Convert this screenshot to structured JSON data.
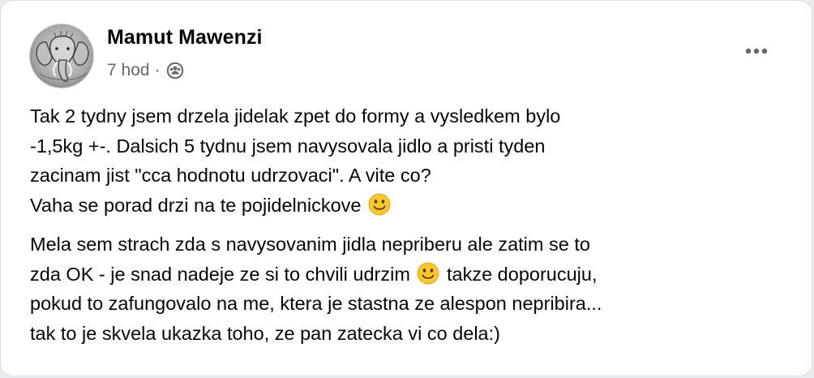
{
  "post": {
    "author": "Mamut Mawenzi",
    "time": "7 hod",
    "separator": "·",
    "audience_icon": "friends-icon",
    "menu_icon": "more-horizontal-icon",
    "paragraphs": [
      {
        "lines": [
          [
            "Tak 2 tydny jsem drzela jidelak zpet do formy a vysledkem bylo"
          ],
          [
            "-1,5kg +-. Dalsich 5 tydnu jsem navysovala jidlo a pristi tyden"
          ],
          [
            "zacinam jist \"cca hodnotu udrzovaci\". A vite co?"
          ],
          [
            "Vaha se porad drzi na te pojidelnickove ",
            ""
          ]
        ]
      },
      {
        "lines": [
          [
            "Mela sem strach zda s navysovanim jidla nepriberu ale zatim se to"
          ],
          [
            "zda OK - je snad nadeje ze si to chvili udrzim ",
            " takze doporucuju,"
          ],
          [
            "pokud to zafungovalo na me, ktera je stastna ze alespon nepribira..."
          ],
          [
            "tak to je skvela ukazka toho, ze pan zatecka vi co dela:)"
          ]
        ]
      }
    ]
  },
  "colors": {
    "card_bg": "#ffffff",
    "text_primary": "#050505",
    "text_secondary": "#65676b",
    "emoji_face": "#f7c72b"
  }
}
